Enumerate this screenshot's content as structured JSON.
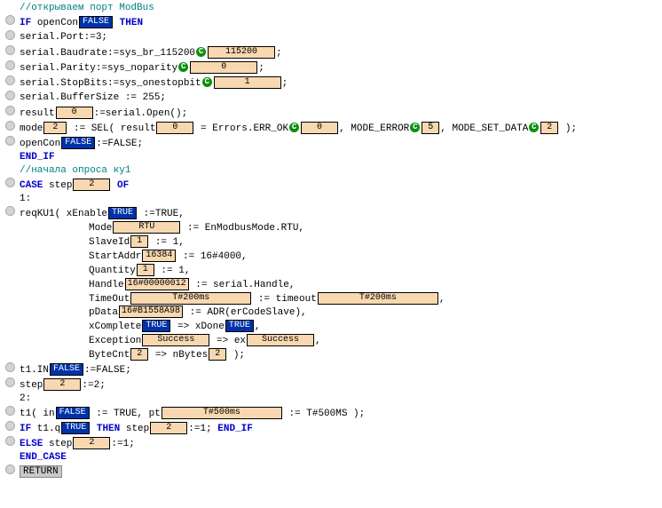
{
  "l1": {
    "cmt": "//открываем порт ModBus"
  },
  "l2": {
    "kw1": "IF",
    "v": "openCon",
    "bval": "FALSE",
    "kw2": "THEN"
  },
  "l3": {
    "t": "serial.Port:=3;"
  },
  "l4": {
    "t": "serial.Baudrate:=sys_br_115200",
    "val": "115200",
    "end": ";"
  },
  "l5": {
    "t": "serial.Parity:=sys_noparity",
    "val": "0",
    "end": ";"
  },
  "l6": {
    "t": "serial.StopBits:=sys_onestopbit",
    "val": "1",
    "end": ";"
  },
  "l7": {
    "t": "serial.BufferSize := 255;"
  },
  "l8": {
    "a": "result",
    "av": "0",
    "b": ":=serial.Open();"
  },
  "l9": {
    "a": "mode",
    "av": "2",
    "mid": " := SEL( result",
    "rv": "0",
    "eq": " = Errors.ERR_OK",
    "ok": "0",
    "me": ", MODE_ERROR",
    "mev": "5",
    "msd": ", MODE_SET_DATA",
    "msdv": "2",
    "end": " );"
  },
  "l10": {
    "a": "openCon",
    "bv": "FALSE",
    "b": ":=FALSE;"
  },
  "l11": {
    "kw": "END_IF"
  },
  "l12": {
    "cmt": "//начала опроса ку1"
  },
  "l13": {
    "kw": "CASE",
    "v": "step",
    "sv": "2",
    "kw2": "OF"
  },
  "l14": {
    "t": "1:"
  },
  "l15": {
    "t": "reqKU1( xEnable",
    "bv": "TRUE",
    "asg": " :=TRUE,"
  },
  "l16": {
    "a": "Mode",
    "val": "RTU",
    "b": " := EnModbusMode.RTU,"
  },
  "l17": {
    "a": "SlaveId",
    "val": "1",
    "b": " := 1,"
  },
  "l18": {
    "a": "StartAddr",
    "val": "16384",
    "b": " := 16#4000,"
  },
  "l19": {
    "a": "Quantity",
    "val": "1",
    "b": " := 1,"
  },
  "l20": {
    "a": "Handle",
    "val": "16#00000012",
    "b": " := serial.Handle,"
  },
  "l21": {
    "a": "TimeOut",
    "val": "T#200ms",
    "b": " := timeout",
    "v2": "T#200ms",
    "end": ","
  },
  "l22": {
    "a": "pData",
    "val": "16#B1558A98",
    "b": " := ADR(erCodeSlave),"
  },
  "l23": {
    "a": "xComplete",
    "bv": "TRUE",
    "b": " => xDone",
    "bv2": "TRUE",
    "end": ","
  },
  "l24": {
    "a": "Exception",
    "val": "Success",
    "b": " => ex",
    "v2": "Success",
    "end": ","
  },
  "l25": {
    "a": "ByteCnt",
    "val": "2",
    "b": " => nBytes",
    "v2": "2",
    "end": " );"
  },
  "l26": {
    "a": "t1.IN",
    "bv": "FALSE",
    "b": ":=FALSE;"
  },
  "l27": {
    "a": "step",
    "val": "2",
    "b": ":=2;"
  },
  "l28": {
    "t": "2:"
  },
  "l29": {
    "a": "t1( in",
    "bv": "FALSE",
    "b": " := TRUE, pt",
    "val": "T#500ms",
    "c": " := T#500MS );"
  },
  "l30": {
    "kw": "IF",
    "a": " t1.q",
    "bv": "TRUE",
    "kw2": "THEN",
    "b": " step",
    "val": "2",
    "c": ":=1; ",
    "kw3": "END_IF"
  },
  "l31": {
    "kw": "ELSE",
    "a": " step",
    "val": "2",
    "b": ":=1;"
  },
  "l32": {
    "kw": "END_CASE"
  },
  "l33": {
    "kw": "RETURN"
  }
}
